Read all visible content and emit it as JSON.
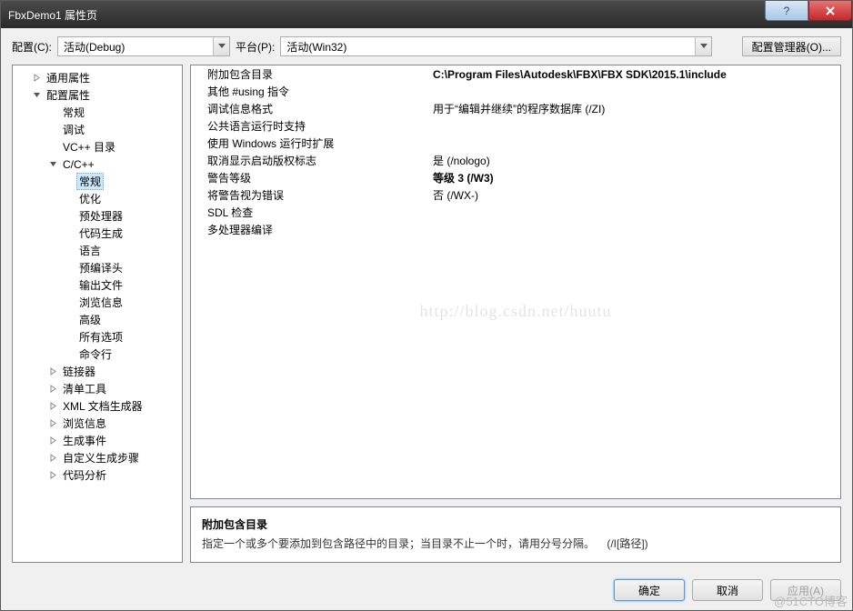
{
  "window": {
    "title": "FbxDemo1 属性页"
  },
  "toolbar": {
    "config_label": "配置(C):",
    "config_value": "活动(Debug)",
    "platform_label": "平台(P):",
    "platform_value": "活动(Win32)",
    "cfgmgr_label": "配置管理器(O)..."
  },
  "tree": {
    "items": [
      {
        "label": "通用属性",
        "level": 1,
        "expander": "collapsed"
      },
      {
        "label": "配置属性",
        "level": 1,
        "expander": "expanded"
      },
      {
        "label": "常规",
        "level": 2
      },
      {
        "label": "调试",
        "level": 2
      },
      {
        "label": "VC++ 目录",
        "level": 2
      },
      {
        "label": "C/C++",
        "level": 2,
        "expander": "expanded"
      },
      {
        "label": "常规",
        "level": 3,
        "selected": true
      },
      {
        "label": "优化",
        "level": 3
      },
      {
        "label": "预处理器",
        "level": 3
      },
      {
        "label": "代码生成",
        "level": 3
      },
      {
        "label": "语言",
        "level": 3
      },
      {
        "label": "预编译头",
        "level": 3
      },
      {
        "label": "输出文件",
        "level": 3
      },
      {
        "label": "浏览信息",
        "level": 3
      },
      {
        "label": "高级",
        "level": 3
      },
      {
        "label": "所有选项",
        "level": 3
      },
      {
        "label": "命令行",
        "level": 3
      },
      {
        "label": "链接器",
        "level": 2,
        "expander": "collapsed"
      },
      {
        "label": "清单工具",
        "level": 2,
        "expander": "collapsed"
      },
      {
        "label": "XML 文档生成器",
        "level": 2,
        "expander": "collapsed"
      },
      {
        "label": "浏览信息",
        "level": 2,
        "expander": "collapsed"
      },
      {
        "label": "生成事件",
        "level": 2,
        "expander": "collapsed"
      },
      {
        "label": "自定义生成步骤",
        "level": 2,
        "expander": "collapsed"
      },
      {
        "label": "代码分析",
        "level": 2,
        "expander": "collapsed"
      }
    ]
  },
  "properties": [
    {
      "name": "附加包含目录",
      "value": "C:\\Program Files\\Autodesk\\FBX\\FBX SDK\\2015.1\\include",
      "bold": true
    },
    {
      "name": "其他 #using 指令",
      "value": ""
    },
    {
      "name": "调试信息格式",
      "value": "用于“编辑并继续”的程序数据库 (/ZI)"
    },
    {
      "name": "公共语言运行时支持",
      "value": ""
    },
    {
      "name": "使用 Windows 运行时扩展",
      "value": ""
    },
    {
      "name": "取消显示启动版权标志",
      "value": "是 (/nologo)"
    },
    {
      "name": "警告等级",
      "value": "等级 3 (/W3)",
      "bold": true
    },
    {
      "name": "将警告视为错误",
      "value": "否 (/WX-)"
    },
    {
      "name": "SDL 检查",
      "value": ""
    },
    {
      "name": "多处理器编译",
      "value": ""
    }
  ],
  "description": {
    "title": "附加包含目录",
    "text": "指定一个或多个要添加到包含路径中的目录；当目录不止一个时，请用分号分隔。    (/I[路径])"
  },
  "footer": {
    "ok": "确定",
    "cancel": "取消",
    "apply": "应用(A)"
  },
  "watermark": "http://blog.csdn.net/huutu",
  "corner": "@51CTO博客"
}
